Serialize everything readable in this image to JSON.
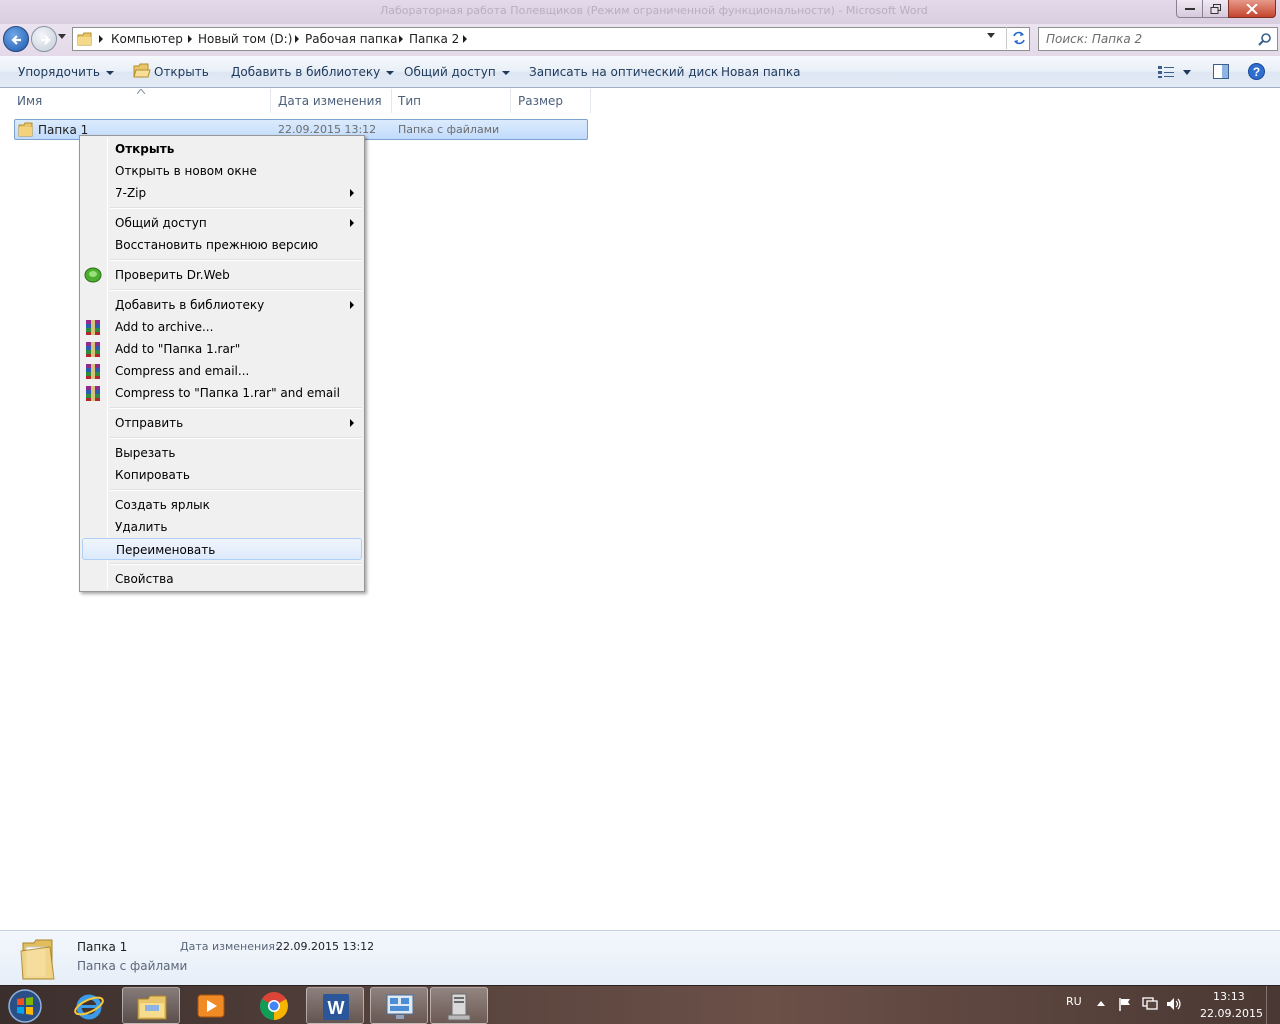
{
  "window": {
    "title": "Лабораторная работа Полевщиков (Режим ограниченной функциональности) - Microsoft Word"
  },
  "address": {
    "crumbs": [
      "Компьютер",
      "Новый том (D:)",
      "Рабочая папка",
      "Папка 2"
    ]
  },
  "search": {
    "placeholder": "Поиск: Папка 2"
  },
  "toolbar": {
    "organize": "Упорядочить",
    "open": "Открыть",
    "add_to_library": "Добавить в библиотеку",
    "share": "Общий доступ",
    "burn": "Записать на оптический диск",
    "new_folder": "Новая папка"
  },
  "columns": {
    "name": "Имя",
    "date": "Дата изменения",
    "type": "Тип",
    "size": "Размер"
  },
  "files": [
    {
      "name": "Папка 1",
      "date": "22.09.2015 13:12",
      "type": "Папка с файлами",
      "size": ""
    }
  ],
  "context_menu": {
    "items": [
      {
        "label": "Открыть",
        "bold": true
      },
      {
        "label": "Открыть в новом окне"
      },
      {
        "label": "7-Zip",
        "submenu": true
      },
      {
        "label": "Общий доступ",
        "submenu": true
      },
      {
        "label": "Восстановить прежнюю версию"
      },
      {
        "label": "Проверить Dr.Web",
        "icon": "drweb-spider-icon"
      },
      {
        "label": "Добавить в библиотеку",
        "submenu": true
      },
      {
        "label": "Add to archive...",
        "icon": "winrar-icon"
      },
      {
        "label": "Add to \"Папка 1.rar\"",
        "icon": "winrar-icon"
      },
      {
        "label": "Compress and email...",
        "icon": "winrar-icon"
      },
      {
        "label": "Compress to \"Папка 1.rar\" and email",
        "icon": "winrar-icon"
      },
      {
        "label": "Отправить",
        "submenu": true
      },
      {
        "label": "Вырезать"
      },
      {
        "label": "Копировать"
      },
      {
        "label": "Создать ярлык"
      },
      {
        "label": "Удалить"
      },
      {
        "label": "Переименовать",
        "highlighted": true
      },
      {
        "label": "Свойства"
      }
    ]
  },
  "details": {
    "name": "Папка 1",
    "type": "Папка с файлами",
    "date_label": "Дата изменения:",
    "date": "22.09.2015 13:12"
  },
  "taskbar": {
    "apps": [
      "internet-explorer-icon",
      "explorer-icon",
      "media-player-icon",
      "chrome-icon",
      "word-icon",
      "remote-desktop-icon",
      "file-server-icon"
    ],
    "active_apps": [
      "explorer-icon"
    ],
    "lang": "RU",
    "time": "13:13",
    "date": "22.09.2015"
  },
  "colors": {
    "accent": "#1d5bb0",
    "selection": "#c1dbfc",
    "menu_highlight": "#dceafc"
  }
}
